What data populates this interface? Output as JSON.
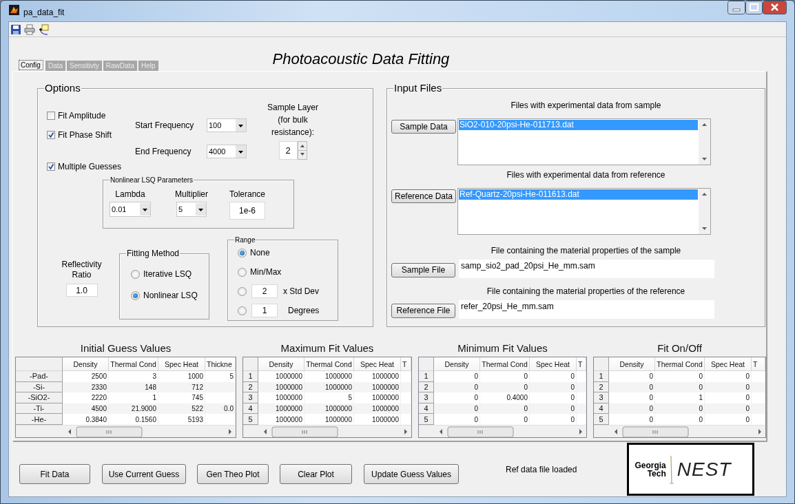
{
  "window": {
    "title": "pa_data_fit"
  },
  "heading": "Photoacoustic Data Fitting",
  "tabs": [
    {
      "label": "Config",
      "selected": true
    },
    {
      "label": "Data",
      "selected": false
    },
    {
      "label": "Sensitivty",
      "selected": false
    },
    {
      "label": "RawData",
      "selected": false
    },
    {
      "label": "Help",
      "selected": false
    }
  ],
  "options": {
    "title": "Options",
    "checkboxes": [
      {
        "label": "Fit Amplitude",
        "checked": false
      },
      {
        "label": "Fit Phase Shift",
        "checked": true
      },
      {
        "label": "Multiple Guesses",
        "checked": true
      }
    ],
    "frequencies": [
      {
        "label": "Start Frequency",
        "value": "100"
      },
      {
        "label": "End Frequency",
        "value": "4000"
      }
    ],
    "sample_layer": {
      "label": "Sample Layer (for bulk resistance):",
      "value": "2"
    },
    "nonlinear": {
      "title": "Nonlinear LSQ Parameters",
      "fields": [
        {
          "kind": "dropdown",
          "label": "Lambda",
          "value": "0.01"
        },
        {
          "kind": "dropdown",
          "label": "Multiplier",
          "value": "5"
        },
        {
          "kind": "text",
          "label": "Tolerance",
          "value": "1e-6"
        }
      ]
    },
    "reflectivity": {
      "label": "Reflectivity Ratio",
      "value": "1.0"
    },
    "fitting_method": {
      "title": "Fitting Method",
      "options": [
        {
          "label": "Iterative LSQ",
          "selected": false
        },
        {
          "label": "Nonlinear LSQ",
          "selected": true
        }
      ]
    },
    "range": {
      "title": "Range",
      "options": [
        {
          "kind": "plain",
          "label": "None",
          "selected": true
        },
        {
          "kind": "plain",
          "label": "Min/Max",
          "selected": false
        },
        {
          "kind": "field",
          "value": "2",
          "label": "x Std Dev",
          "selected": false
        },
        {
          "kind": "field",
          "value": "1",
          "label": "Degrees",
          "selected": false
        }
      ]
    }
  },
  "input_files": {
    "title": "Input Files",
    "sections": [
      {
        "kind": "list",
        "caption": "Files with experimental data from sample",
        "button": "Sample Data",
        "items": [
          {
            "label": "SiO2-010-20psi-He-011713.dat",
            "selected": true
          }
        ]
      },
      {
        "kind": "list",
        "caption": "Files with experimental data from reference",
        "button": "Reference Data",
        "items": [
          {
            "label": "Ref-Quartz-20psi-He-011613.dat",
            "selected": true
          }
        ]
      },
      {
        "kind": "file",
        "caption": "File containing the material properties of the sample",
        "button": "Sample File",
        "value": "samp_sio2_pad_20psi_He_mm.sam"
      },
      {
        "kind": "file",
        "caption": "File containing the material properties of the reference",
        "button": "Reference File",
        "value": "refer_20psi_He_mm.sam"
      }
    ]
  },
  "tables": [
    {
      "title": "Initial Guess Values",
      "columns": [
        "Density",
        "Thermal Cond",
        "Spec Heat",
        "Thickne"
      ],
      "rows": [
        {
          "header": "-Pad-",
          "cells": [
            "2500",
            "3",
            "1000",
            "5"
          ]
        },
        {
          "header": "-Si-",
          "cells": [
            "2330",
            "148",
            "712"
          ]
        },
        {
          "header": "-SiO2-",
          "cells": [
            "2220",
            "1",
            "745"
          ]
        },
        {
          "header": "-Ti-",
          "cells": [
            "4500",
            "21.9000",
            "522",
            "0.0"
          ]
        },
        {
          "header": "-He-",
          "cells": [
            "0.3840",
            "0.1560",
            "5193"
          ]
        }
      ]
    },
    {
      "title": "Maximum Fit Values",
      "columns": [
        "Density",
        "Thermal Cond",
        "Spec Heat",
        "T"
      ],
      "rows": [
        {
          "header": "1",
          "cells": [
            "1000000",
            "1000000",
            "1000000"
          ]
        },
        {
          "header": "2",
          "cells": [
            "1000000",
            "1000000",
            "1000000"
          ]
        },
        {
          "header": "3",
          "cells": [
            "1000000",
            "5",
            "1000000"
          ]
        },
        {
          "header": "4",
          "cells": [
            "1000000",
            "1000000",
            "1000000"
          ]
        },
        {
          "header": "5",
          "cells": [
            "1000000",
            "1000000",
            "1000000"
          ]
        }
      ]
    },
    {
      "title": "Minimum Fit Values",
      "columns": [
        "Density",
        "Thermal Cond",
        "Spec Heat",
        "T"
      ],
      "rows": [
        {
          "header": "1",
          "cells": [
            "0",
            "0",
            "0"
          ]
        },
        {
          "header": "2",
          "cells": [
            "0",
            "0",
            "0"
          ]
        },
        {
          "header": "3",
          "cells": [
            "0",
            "0.4000",
            "0"
          ]
        },
        {
          "header": "4",
          "cells": [
            "0",
            "0",
            "0"
          ]
        },
        {
          "header": "5",
          "cells": [
            "0",
            "0",
            "0"
          ]
        }
      ]
    },
    {
      "title": "Fit On/Off",
      "columns": [
        "Density",
        "Thermal Cond",
        "Spec Heat",
        "T"
      ],
      "rows": [
        {
          "header": "1",
          "cells": [
            "0",
            "0",
            "0"
          ]
        },
        {
          "header": "2",
          "cells": [
            "0",
            "0",
            "0"
          ]
        },
        {
          "header": "3",
          "cells": [
            "0",
            "1",
            "0"
          ]
        },
        {
          "header": "4",
          "cells": [
            "0",
            "0",
            "0"
          ]
        },
        {
          "header": "5",
          "cells": [
            "0",
            "0",
            "0"
          ]
        }
      ]
    }
  ],
  "buttons": [
    "Fit Data",
    "Use Current Guess",
    "Gen Theo Plot",
    "Clear Plot",
    "Update Guess Values"
  ],
  "status": "Ref data file loaded",
  "logo": {
    "left_lines": [
      "Georgia",
      "Tech"
    ],
    "right": "NEST"
  }
}
